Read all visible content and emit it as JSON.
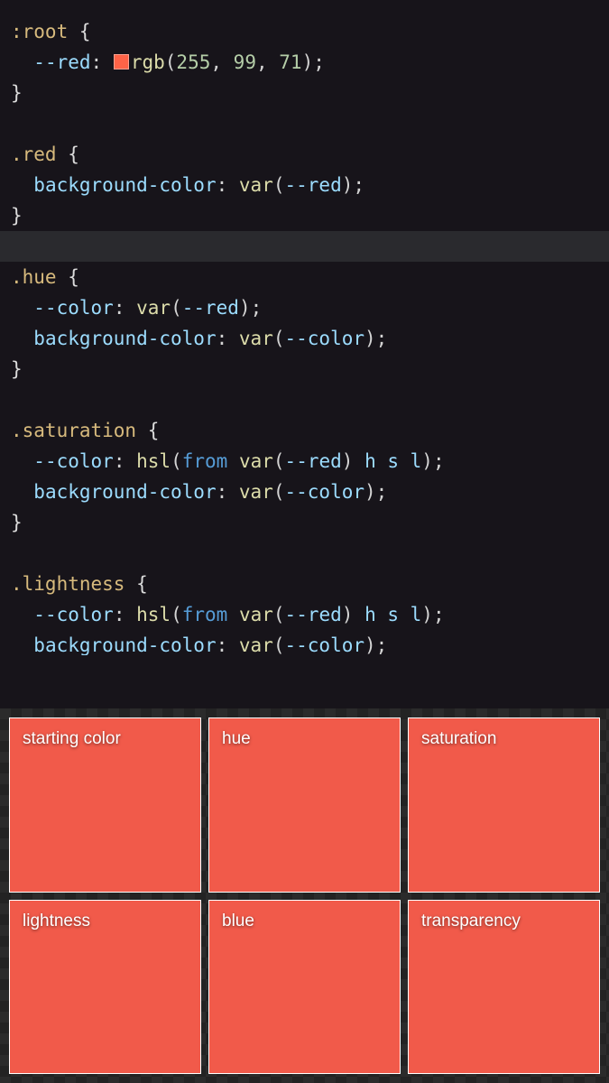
{
  "code": {
    "root_selector": ":root",
    "root_var": "--red",
    "rgb_func": "rgb",
    "rgb_vals": [
      "255",
      "99",
      "71"
    ],
    "red_selector": ".red",
    "bg_prop": "background-color",
    "var_func": "var",
    "red_varref": "--red",
    "hue_selector": ".hue",
    "color_var": "--color",
    "saturation_selector": ".saturation",
    "hsl_func": "hsl",
    "from_kw": "from",
    "hsl_args": "h s l",
    "lightness_selector": ".lightness",
    "color_varref": "--color"
  },
  "swatches": [
    {
      "label": "starting color"
    },
    {
      "label": "hue"
    },
    {
      "label": "saturation"
    },
    {
      "label": "lightness"
    },
    {
      "label": "blue"
    },
    {
      "label": "transparency"
    }
  ],
  "colors": {
    "swatch_fill": "#f15a4a",
    "editor_bg": "#17141a"
  }
}
